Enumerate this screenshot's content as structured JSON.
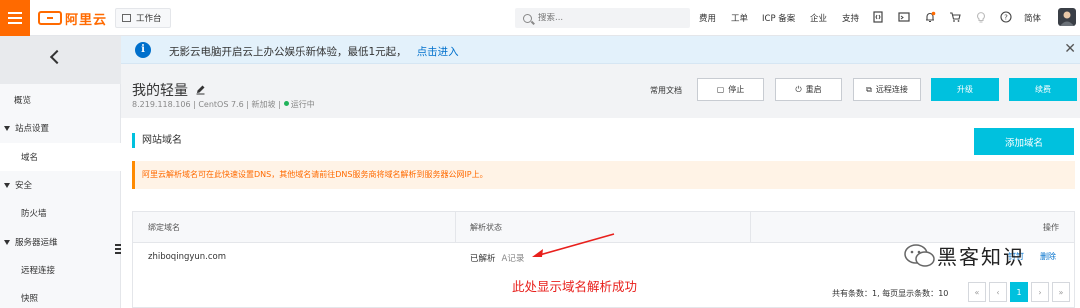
{
  "topbar": {
    "logo_text": "阿里云",
    "workbench": "工作台",
    "search_placeholder": "搜索...",
    "nav": [
      "费用",
      "工单",
      "ICP 备案",
      "企业",
      "支持"
    ],
    "language": "简体",
    "brand_color": "#ff6a00"
  },
  "sidebar": {
    "items": [
      {
        "label": "概览"
      },
      {
        "label": "站点设置"
      },
      {
        "label": "域名"
      },
      {
        "label": "安全"
      },
      {
        "label": "防火墙"
      },
      {
        "label": "服务器运维"
      },
      {
        "label": "远程连接"
      },
      {
        "label": "快照"
      }
    ]
  },
  "notice": {
    "message": "无影云电脑开启云上办公娱乐新体验，最低1元起，",
    "link": "点击进入"
  },
  "instance": {
    "title": "我的轻量",
    "ip": "8.219.118.106",
    "os": "CentOS 7.6",
    "region": "新加坡",
    "status": "运行中",
    "docs": "常用文档",
    "buttons": {
      "stop": "停止",
      "restart": "重启",
      "remote": "远程连接",
      "upgrade": "升级",
      "renew": "续费"
    },
    "accent_color": "#00c1de"
  },
  "domains": {
    "section_title": "网站域名",
    "add_button": "添加域名",
    "warning": "阿里云解析域名可在此快速设置DNS，其他域名请前往DNS服务商将域名解析到服务器公网IP上。",
    "columns": [
      "绑定域名",
      "解析状态",
      "操作"
    ],
    "rows": [
      {
        "domain": "zhiboqingyun.com",
        "status": "已解析",
        "record": "A记录",
        "op_partial": "钉钉",
        "op_delete": "删除"
      }
    ],
    "pager": {
      "total_label": "共有条数：",
      "total": "1",
      "per_page_label": "每页显示条数：",
      "per_page": "10",
      "first": "«",
      "prev": "‹",
      "current": "1",
      "next": "›",
      "last": "»"
    }
  },
  "annotation": {
    "text": "此处显示域名解析成功",
    "color": "#e8201c"
  },
  "watermark": {
    "text": "黑客知识"
  }
}
